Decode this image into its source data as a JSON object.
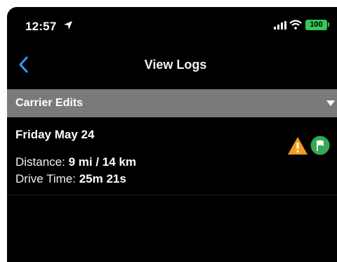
{
  "status_bar": {
    "time": "12:57",
    "battery": "100",
    "icons": [
      "location-arrow-icon",
      "signal-bars-icon",
      "wifi-icon",
      "battery-icon"
    ]
  },
  "nav": {
    "back_icon": "chevron-left-icon",
    "title": "View Logs"
  },
  "section": {
    "label": "Carrier Edits",
    "toggle_icon": "caret-down-icon"
  },
  "logs": [
    {
      "date": "Friday May 24",
      "distance_label": "Distance:",
      "distance_value": "9 mi / 14 km",
      "drive_label": "Drive Time:",
      "drive_value": "25m 21s",
      "icons": [
        "warning-icon",
        "flag-icon"
      ]
    }
  ],
  "colors": {
    "accent": "#2f9bff",
    "header_bg": "#7a7a7a",
    "warning": "#f39c1e",
    "flag_green": "#34a853",
    "battery": "#35c759"
  }
}
